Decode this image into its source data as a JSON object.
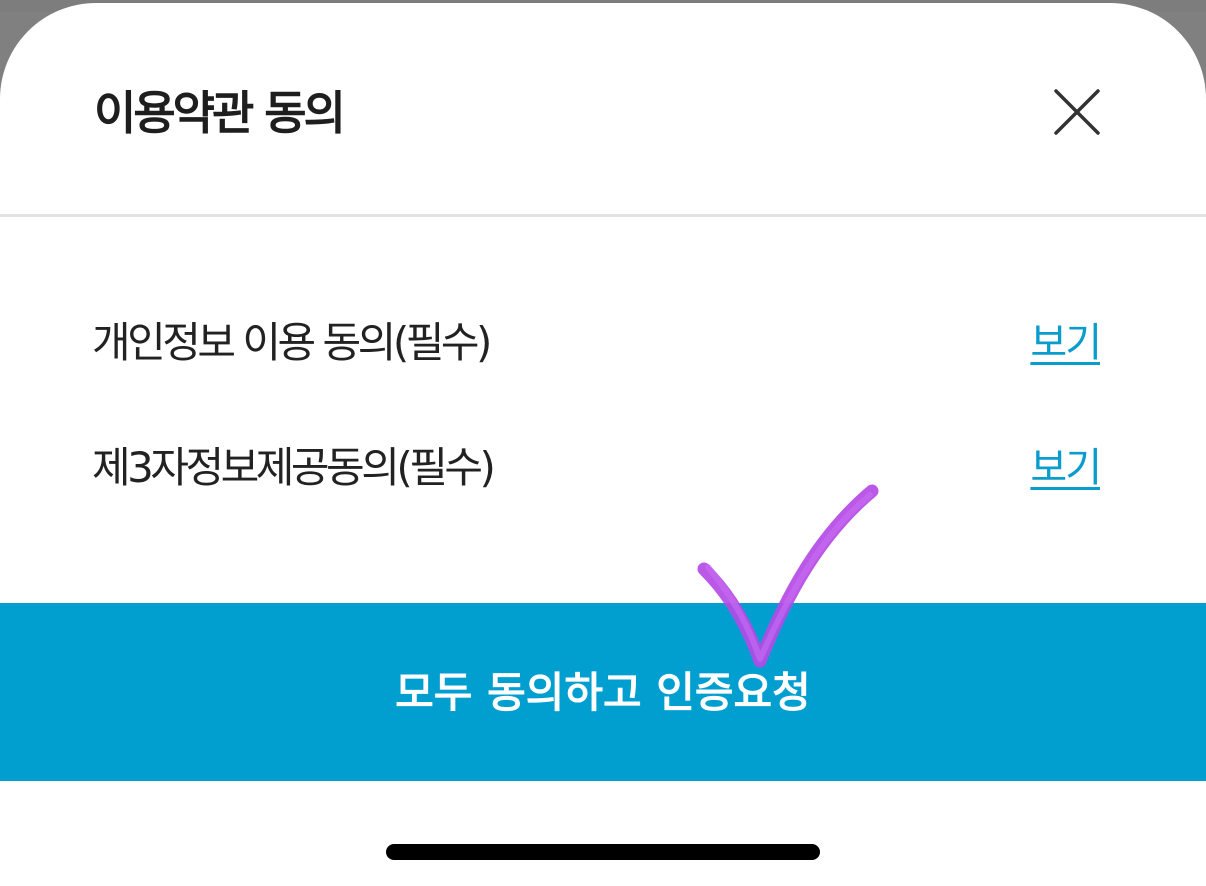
{
  "modal": {
    "title": "이용약관 동의",
    "close_icon": "close-icon"
  },
  "terms": [
    {
      "label": "개인정보 이용 동의(필수)",
      "link": "보기"
    },
    {
      "label": "제3자정보제공동의(필수)",
      "link": "보기"
    }
  ],
  "action": {
    "agree_label": "모두 동의하고 인증요청"
  },
  "colors": {
    "accent": "#009fd0",
    "link": "#0a9ccc",
    "annotation": "#b44ae6"
  }
}
